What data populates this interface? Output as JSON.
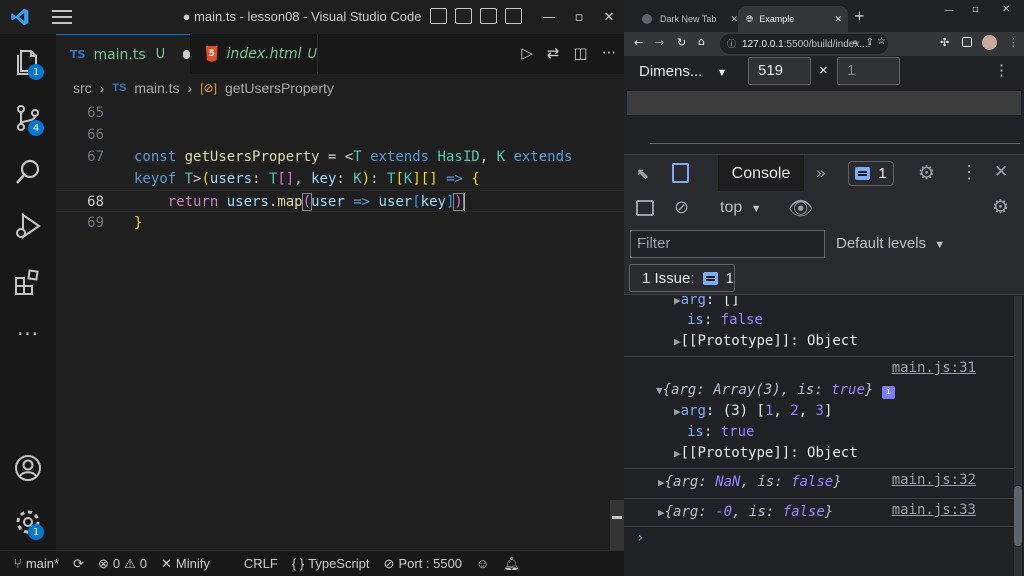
{
  "vscode": {
    "window_title": "● main.ts - lesson08 - Visual Studio Code",
    "activity_badges": {
      "explorer": "1",
      "source_control": "4",
      "settings": "1"
    },
    "tabs": [
      {
        "icon": "TS",
        "name": "main.ts",
        "status": "U",
        "modified": true,
        "active": true
      },
      {
        "icon": "5",
        "name": "index.html",
        "status": "U",
        "active": false
      }
    ],
    "breadcrumb": {
      "folder": "src",
      "icon": "TS",
      "file": "main.ts",
      "symbol": "getUsersProperty",
      "symbol_icon": "[⊘]"
    },
    "line_numbers": [
      "65",
      "66",
      "67",
      "",
      "68",
      "69"
    ],
    "current_line": "68",
    "status": {
      "branch": "main*",
      "errors": "0",
      "warnings": "0",
      "minify": "Minify",
      "eol": "CRLF",
      "language_braces": "{ }",
      "language": "TypeScript",
      "port": "Port : 5500"
    }
  },
  "browser": {
    "tabs": [
      "Dark New Tab",
      "Example"
    ],
    "url_host": "127.0.0.1",
    "url_rest": ":5500/build/index....",
    "device_label": "Dimens...",
    "width": "519",
    "height": "1",
    "devtools": {
      "active_tab": "Console",
      "message_count": "1",
      "context": "top",
      "filter_placeholder": "Filter",
      "levels": "Default levels",
      "issues_label": "1 Issue:",
      "issues_count": "1",
      "links": [
        "main.js:31",
        "main.js:32",
        "main.js:33"
      ]
    }
  },
  "colors": {
    "accent": "#0078d4",
    "ts": "#3178c6",
    "untracked": "#73c991"
  }
}
